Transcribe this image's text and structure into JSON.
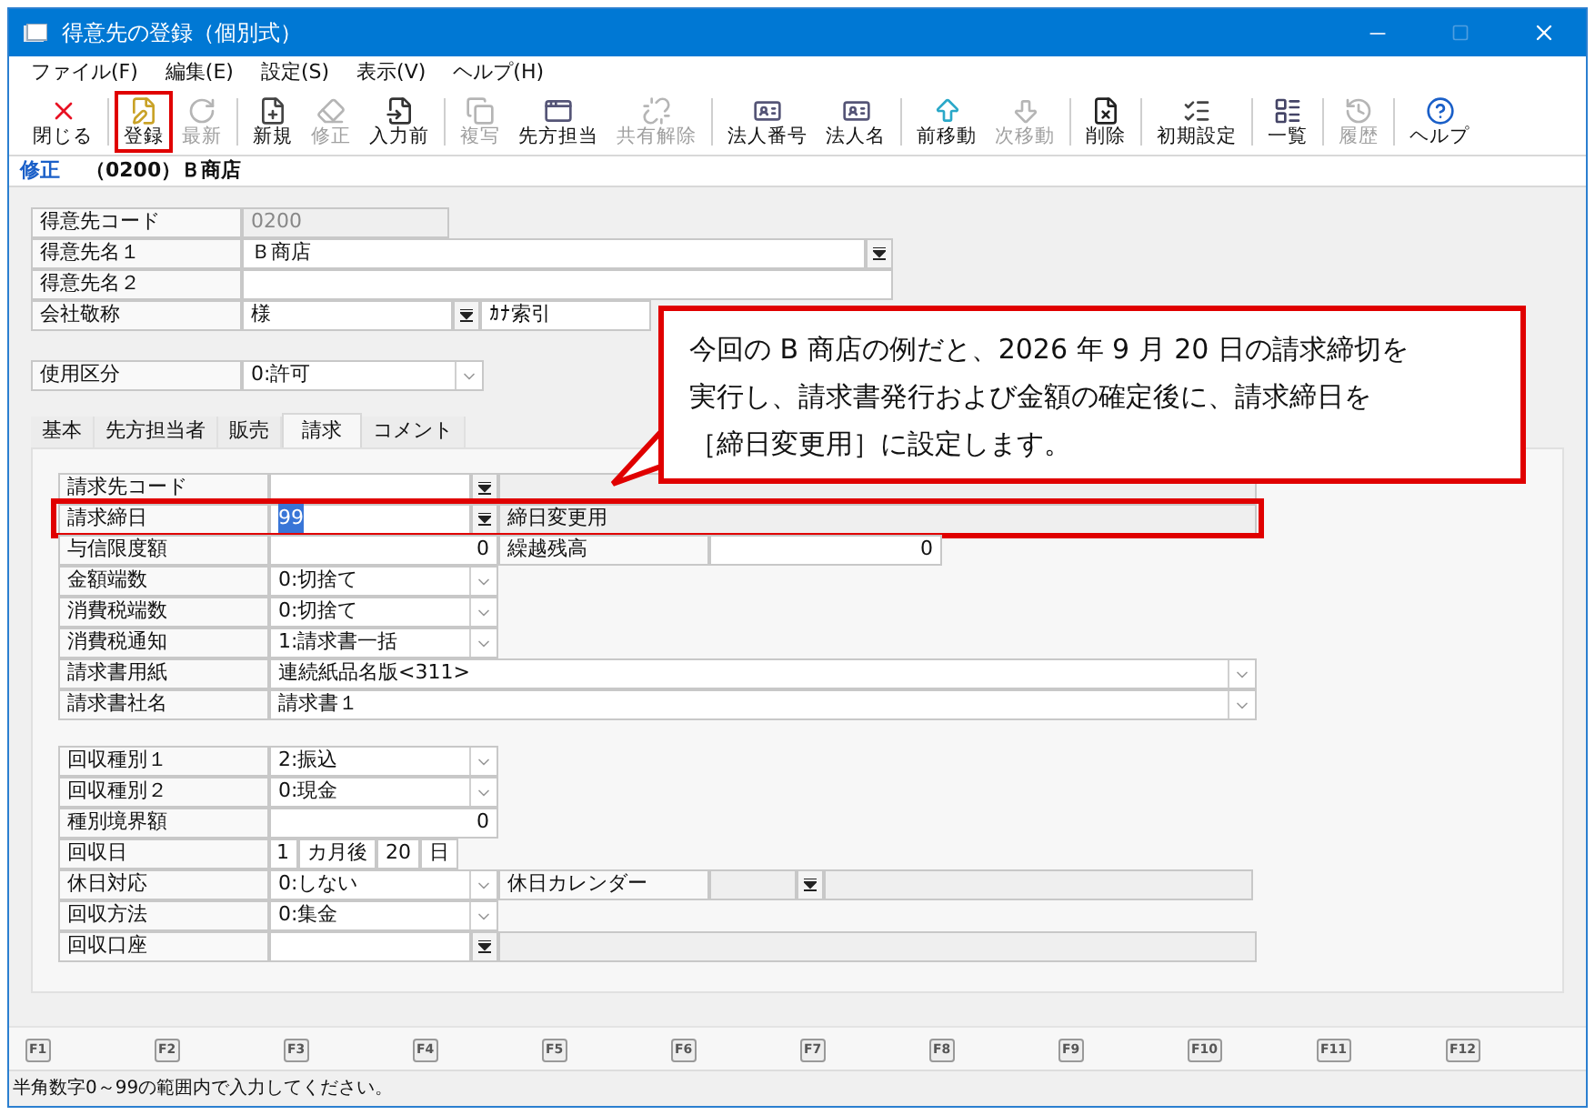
{
  "window": {
    "title": "得意先の登録（個別式）"
  },
  "menu": [
    "ファイル(F)",
    "編集(E)",
    "設定(S)",
    "表示(V)",
    "ヘルプ(H)"
  ],
  "toolbar": [
    [
      {
        "label": "閉じる",
        "disabled": false,
        "highlighted": false
      }
    ],
    [
      {
        "label": "登録",
        "disabled": false,
        "highlighted": true
      },
      {
        "label": "最新",
        "disabled": true,
        "highlighted": false
      }
    ],
    [
      {
        "label": "新規",
        "disabled": false,
        "highlighted": false
      },
      {
        "label": "修正",
        "disabled": true,
        "highlighted": false
      },
      {
        "label": "入力前",
        "disabled": false,
        "highlighted": false
      }
    ],
    [
      {
        "label": "複写",
        "disabled": true,
        "highlighted": false
      },
      {
        "label": "先方担当",
        "disabled": false,
        "highlighted": false
      },
      {
        "label": "共有解除",
        "disabled": true,
        "highlighted": false
      }
    ],
    [
      {
        "label": "法人番号",
        "disabled": false,
        "highlighted": false
      },
      {
        "label": "法人名",
        "disabled": false,
        "highlighted": false
      }
    ],
    [
      {
        "label": "前移動",
        "disabled": false,
        "highlighted": false
      },
      {
        "label": "次移動",
        "disabled": true,
        "highlighted": false
      }
    ],
    [
      {
        "label": "削除",
        "disabled": false,
        "highlighted": false
      }
    ],
    [
      {
        "label": "初期設定",
        "disabled": false,
        "highlighted": false
      }
    ],
    [
      {
        "label": "一覧",
        "disabled": false,
        "highlighted": false
      }
    ],
    [
      {
        "label": "履歴",
        "disabled": true,
        "highlighted": false
      }
    ],
    [
      {
        "label": "ヘルプ",
        "disabled": false,
        "highlighted": false
      }
    ]
  ],
  "mode": {
    "label": "修正",
    "record": "（0200）Ｂ商店"
  },
  "header_fields": [
    {
      "kind": "readonly",
      "label": "得意先コード",
      "value": "0200"
    },
    {
      "kind": "lookup_wide",
      "label": "得意先名１",
      "value": "Ｂ商店"
    },
    {
      "kind": "text_wide",
      "label": "得意先名２"
    },
    {
      "kind": "honorific",
      "label": "会社敬称",
      "value": "様",
      "side_label": "ｶﾅ索引"
    }
  ],
  "usage": {
    "label": "使用区分",
    "value": "0:許可"
  },
  "tabs": [
    {
      "label": "基本",
      "selected": false
    },
    {
      "label": "先方担当者",
      "selected": false
    },
    {
      "label": "販売",
      "selected": false
    },
    {
      "label": "請求",
      "selected": true
    },
    {
      "label": "コメント",
      "selected": false
    }
  ],
  "billing_groups": [
    [
      {
        "kind": "lookup",
        "label": "請求先コード",
        "highlighted": false
      },
      {
        "kind": "lookup",
        "label": "請求締日",
        "value": "99",
        "text_selected": true,
        "side_value": "締日変更用",
        "highlighted": true
      },
      {
        "kind": "amount",
        "label": "与信限度額",
        "value": "0",
        "side_label": "繰越残高",
        "side_value": "0"
      },
      {
        "kind": "select",
        "label": "金額端数",
        "value": "0:切捨て"
      },
      {
        "kind": "select",
        "label": "消費税端数",
        "value": "0:切捨て"
      },
      {
        "kind": "select",
        "label": "消費税通知",
        "value": "1:請求書一括"
      },
      {
        "kind": "select_wide",
        "label": "請求書用紙",
        "value": "連続紙品名版<311>"
      },
      {
        "kind": "select_wide",
        "label": "請求書社名",
        "value": "請求書１"
      }
    ],
    [
      {
        "kind": "select",
        "label": "回収種別１",
        "value": "2:振込"
      },
      {
        "kind": "select",
        "label": "回収種別２",
        "value": "0:現金"
      },
      {
        "kind": "amount",
        "label": "種別境界額",
        "value": "0"
      },
      {
        "kind": "due",
        "label": "回収日",
        "value": "1",
        "unit": "カ月後",
        "day": "20",
        "day_unit": "日"
      },
      {
        "kind": "select_calendar",
        "label": "休日対応",
        "value": "0:しない",
        "side_label": "休日カレンダー"
      },
      {
        "kind": "select",
        "label": "回収方法",
        "value": "0:集金"
      },
      {
        "kind": "lookup",
        "label": "回収口座",
        "highlighted": false
      }
    ]
  ],
  "function_keys": [
    "F1",
    "F2",
    "F3",
    "F4",
    "F5",
    "F6",
    "F7",
    "F8",
    "F9",
    "F10",
    "F11",
    "F12"
  ],
  "status_bar": "半角数字0～99の範囲内で入力してください。",
  "callout": {
    "lines": [
      "今回の B 商店の例だと、2026 年 9 月 20 日の請求締切を",
      "実行し、請求書発行および金額の確定後に、請求締日を",
      "［締日変更用］に設定します。"
    ]
  }
}
